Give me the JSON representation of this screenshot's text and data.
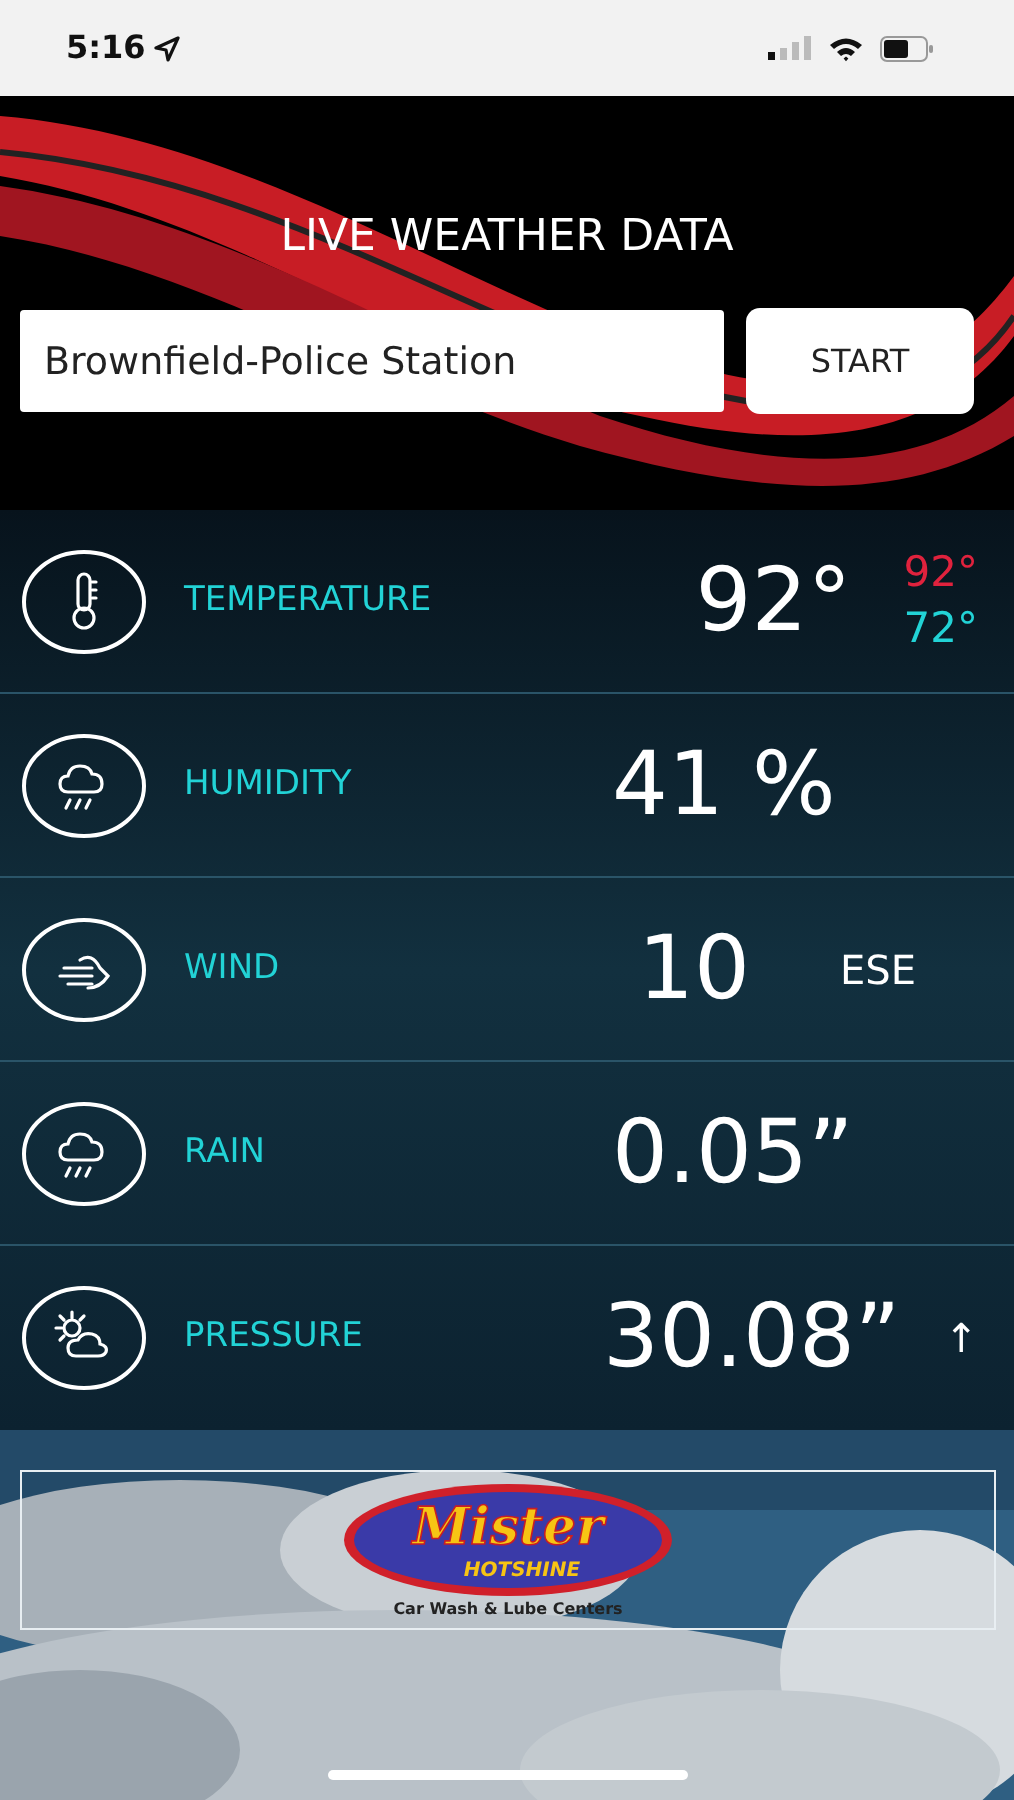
{
  "status_bar": {
    "time": "5:16"
  },
  "title": "LIVE WEATHER DATA",
  "station": {
    "value": "Brownfield-Police Station"
  },
  "start_button": "START",
  "rows": [
    {
      "kind": "hilo",
      "label": "TEMPERATURE",
      "value": "92°",
      "high": "92°",
      "low": "72°"
    },
    {
      "kind": "plain",
      "label": "HUMIDITY",
      "value": "41 %"
    },
    {
      "kind": "unit",
      "label": "WIND",
      "value": "10",
      "direction": "ESE"
    },
    {
      "kind": "plain",
      "label": "RAIN",
      "value": "0.05”"
    },
    {
      "kind": "trend",
      "label": "PRESSURE",
      "value": "30.08”",
      "trend": "↑"
    }
  ],
  "ad": {
    "brand": "Mister",
    "brand_line_2": "HOTSHINE",
    "tagline": "Car Wash & Lube Centers"
  }
}
